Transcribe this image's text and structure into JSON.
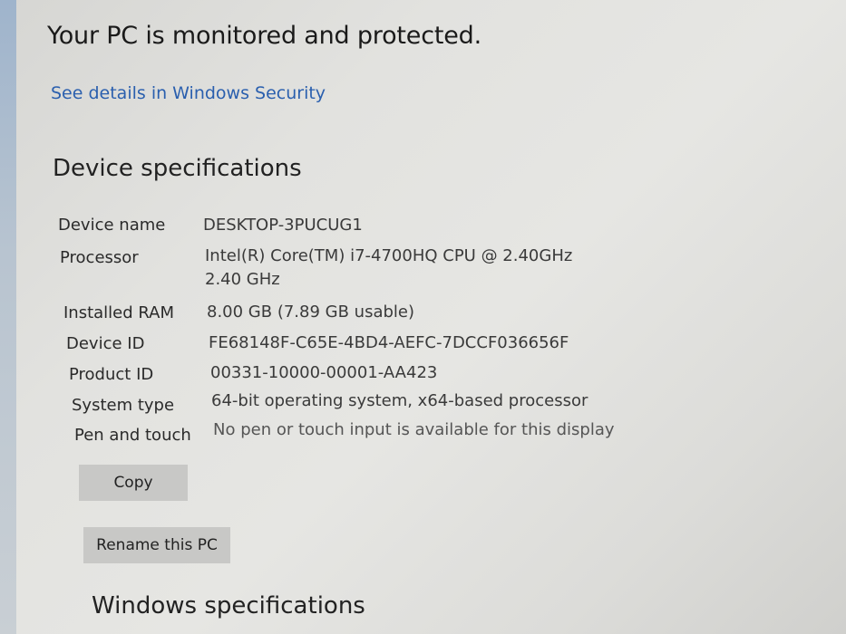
{
  "security": {
    "title": "Your PC is monitored and protected.",
    "link": "See details in Windows Security"
  },
  "device_specs": {
    "heading": "Device specifications",
    "rows": [
      {
        "label": "Device name",
        "value": "DESKTOP-3PUCUG1"
      },
      {
        "label": "Processor",
        "value": "Intel(R) Core(TM) i7-4700HQ CPU @ 2.40GHz   2.40 GHz"
      },
      {
        "label": "Installed RAM",
        "value": "8.00 GB (7.89 GB usable)"
      },
      {
        "label": "Device ID",
        "value": "FE68148F-C65E-4BD4-AEFC-7DCCF036656F"
      },
      {
        "label": "Product ID",
        "value": "00331-10000-00001-AA423"
      },
      {
        "label": "System type",
        "value": "64-bit operating system, x64-based processor"
      },
      {
        "label": "Pen and touch",
        "value": "No pen or touch input is available for this display"
      }
    ],
    "copy_button": "Copy"
  },
  "rename_button": "Rename this PC",
  "windows_specs": {
    "heading": "Windows specifications"
  }
}
